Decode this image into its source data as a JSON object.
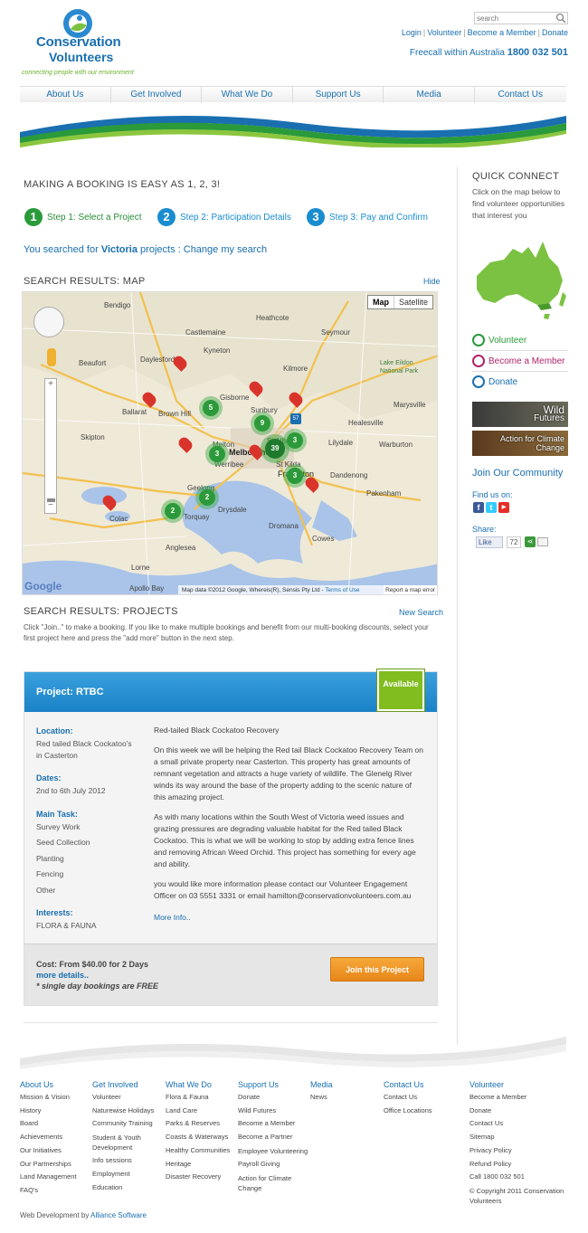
{
  "header": {
    "logo_line1": "Conservation",
    "logo_line2": "Volunteers",
    "tagline": "connecting people with our environment",
    "search_placeholder": "search",
    "top_links": [
      "Login",
      "Volunteer",
      "Become a Member",
      "Donate"
    ],
    "freecall_label": "Freecall within Australia",
    "freecall_number": "1800 032 501"
  },
  "nav": [
    "About Us",
    "Get Involved",
    "What We Do",
    "Support Us",
    "Media",
    "Contact Us"
  ],
  "main": {
    "heading": "MAKING A BOOKING IS EASY AS 1, 2, 3!",
    "steps": [
      {
        "num": "1",
        "label": "Step 1: Select a Project",
        "color": "#2a9a3a"
      },
      {
        "num": "2",
        "label": "Step 2: Participation Details",
        "color": "#1a8cd0"
      },
      {
        "num": "3",
        "label": "Step 3: Pay and Confirm",
        "color": "#1a8cd0"
      }
    ],
    "searched_prefix": "You searched for",
    "searched_term": "Victoria",
    "searched_suffix": "projects :",
    "change_search": "Change my search",
    "map_heading": "SEARCH RESULTS: MAP",
    "hide_link": "Hide",
    "projects_heading": "SEARCH RESULTS: PROJECTS",
    "new_search_link": "New Search",
    "projects_intro": "Click \"Join..\" to make a booking. If you like to make multiple bookings and benefit from our multi-booking discounts, select your first project here and press the \"add more\" button in the next step."
  },
  "map": {
    "btn_map": "Map",
    "btn_satellite": "Satellite",
    "attribution": "Map data ©2012 Google, Whereis(R), Sensis Pty Ltd -",
    "terms": "Terms of Use",
    "report": "Report a map error",
    "google": "Google",
    "places": [
      "Bendigo",
      "Castlemaine",
      "Beaufort",
      "Ballarat",
      "Brown Hill",
      "Gisborne",
      "Sunbury",
      "Melton",
      "Melbourne",
      "St Albans",
      "Werribee",
      "St Kilda",
      "Geelong",
      "Torquay",
      "Frankston",
      "Dandenong",
      "Colac",
      "Anglesea",
      "Lorne",
      "Apollo Bay",
      "Skipton",
      "Daylesford",
      "Kyneton",
      "Heathcote",
      "Kilmore",
      "Marysville",
      "Lilydale",
      "Warburton",
      "Healesville",
      "Cowes",
      "Dromana",
      "Lake Eildon National Park",
      "Seymour",
      "Pakenham",
      "Drysdale"
    ],
    "clusters": [
      "5",
      "9",
      "39",
      "3",
      "3",
      "3",
      "2",
      "2",
      "57"
    ]
  },
  "project": {
    "title": "Project: RTBC",
    "status": "Available",
    "location_label": "Location:",
    "location_value": "Red tailed Black Cockatoo's in Casterton",
    "dates_label": "Dates:",
    "dates_value": "2nd to 6th July 2012",
    "task_label": "Main Task:",
    "tasks": [
      "Survey Work",
      "Seed Collection",
      "Planting",
      "Fencing",
      "Other"
    ],
    "interests_label": "Interests:",
    "interests_value": "FLORA & FAUNA",
    "desc_title": "Red-tailed Black Cockatoo Recovery",
    "desc_p1": "On this week we will be helping the Red tail Black Cockatoo Recovery Team on a small private property near Casterton. This property has great amounts of remnant vegetation and attracts a huge variety of wildlife. The Glenelg River winds its way around the base of the property adding to the scenic nature of this amazing project.",
    "desc_p2": "As with many locations within the South West of Victoria weed issues and grazing pressures are degrading valuable habitat for the Red tailed Black Cockatoo. This is what we will be working to stop by adding extra fence lines and removing African Weed Orchid. This project has something for every age and ability.",
    "desc_p3": "you would like more information please contact our Volunteer Engagement Officer on 03 5551 3331 or email hamilton@conservationvolunteers.com.au",
    "more_info": "More Info..",
    "cost": "Cost: From $40.00 for 2 Days",
    "more_details": "more details..",
    "free_note": "* single day bookings are FREE",
    "join_button": "Join this Project"
  },
  "sidebar": {
    "heading": "QUICK CONNECT",
    "text": "Click on the map below to find volunteer opportunities that interest you",
    "links": [
      {
        "label": "Volunteer",
        "color": "#2a9a3a"
      },
      {
        "label": "Become a Member",
        "color": "#b0236a"
      },
      {
        "label": "Donate",
        "color": "#1a6fb0"
      }
    ],
    "banner1_a": "Wild",
    "banner1_b": "Futures",
    "banner2_a": "Action for Climate",
    "banner2_b": "Change",
    "join_community": "Join Our Community",
    "find_us": "Find us on:",
    "share": "Share:",
    "like": "Like",
    "like_count": "72"
  },
  "footer": {
    "columns": [
      {
        "heading": "About Us",
        "items": [
          "Mission & Vision",
          "History",
          "Board",
          "Achievements",
          "Our Initiatives",
          "Our Partnerships",
          "Land Management",
          "FAQ's"
        ]
      },
      {
        "heading": "Get Involved",
        "items": [
          "Volunteer",
          "Naturewise Holidays",
          "Community Training",
          "Student & Youth Development",
          "Info sessions",
          "Employment",
          "Education"
        ]
      },
      {
        "heading": "What We Do",
        "items": [
          "Flora & Fauna",
          "Land Care",
          "Parks & Reserves",
          "Coasts & Waterways",
          "Healthy Communities",
          "Heritage",
          "Disaster Recovery"
        ]
      },
      {
        "heading": "Support Us",
        "items": [
          "Donate",
          "Wild Futures",
          "Become a Member",
          "Become a Partner",
          "Employee Volunteering",
          "Payroll Giving",
          "Action for Climate Change"
        ]
      },
      {
        "heading": "Media",
        "items": [
          "News"
        ]
      },
      {
        "heading": "Contact Us",
        "items": [
          "Contact Us",
          "Office Locations"
        ]
      },
      {
        "heading": "Volunteer",
        "items": [
          "Become a Member",
          "Donate",
          "Contact Us",
          "Sitemap",
          "Privacy Policy",
          "Refund Policy",
          "Call 1800 032 501",
          "© Copyright 2011 Conservation Volunteers"
        ]
      }
    ],
    "webdev_prefix": "Web Development by",
    "webdev_link": "Alliance Software"
  }
}
